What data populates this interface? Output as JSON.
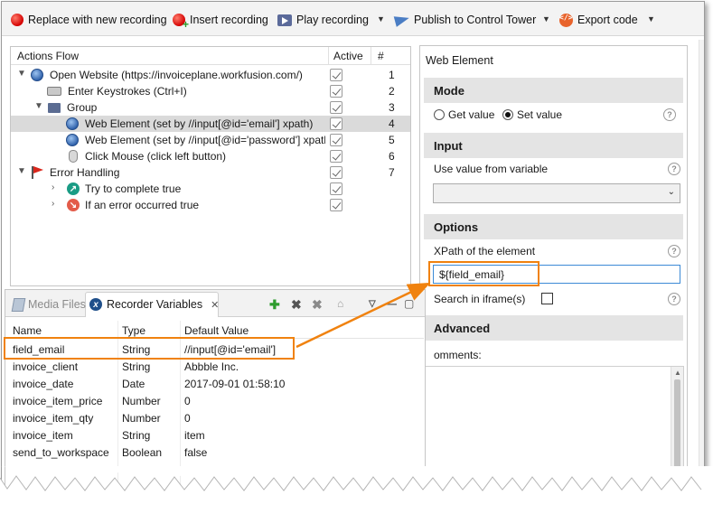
{
  "toolbar": {
    "replace_label": "Replace with new recording",
    "insert_label": "Insert recording",
    "play_label": "Play recording",
    "publish_label": "Publish to Control Tower",
    "export_label": "Export code"
  },
  "actions_flow": {
    "header": {
      "name": "Actions Flow",
      "active": "Active",
      "num": "#"
    },
    "rows": [
      {
        "label": "Open Website (https://invoiceplane.workfusion.com/)",
        "num": "1",
        "icon": "globe-icon"
      },
      {
        "label": "Enter Keystrokes (Ctrl+I)",
        "num": "2",
        "icon": "keyboard-icon"
      },
      {
        "label": "Group",
        "num": "3",
        "icon": "folder-icon"
      },
      {
        "label": "Web Element (set by //input[@id='email'] xpath)",
        "num": "4",
        "icon": "globe-icon",
        "selected": true
      },
      {
        "label": "Web Element (set by //input[@id='password'] xpath)",
        "num": "5",
        "icon": "globe-icon"
      },
      {
        "label": "Click Mouse (click left button)",
        "num": "6",
        "icon": "mouse-icon"
      },
      {
        "label": "Error Handling",
        "num": "7",
        "icon": "flag-icon"
      },
      {
        "label": "Try to complete true",
        "num": "",
        "icon": "try-icon"
      },
      {
        "label": "If an error occurred true",
        "num": "",
        "icon": "error-icon"
      }
    ]
  },
  "web_element": {
    "title": "Web Element",
    "mode": {
      "heading": "Mode",
      "get_label": "Get value",
      "set_label": "Set value",
      "selected": "Set value"
    },
    "input": {
      "heading": "Input",
      "variable_label": "Use value from variable",
      "variable_value": ""
    },
    "options": {
      "heading": "Options",
      "xpath_label": "XPath of the element",
      "xpath_value": "${field_email}",
      "iframe_label": "Search in iframe(s)"
    },
    "advanced": {
      "heading": "Advanced",
      "comments_label": "omments:"
    }
  },
  "bottom_panel": {
    "tabs": {
      "media": "Media Files",
      "recorder": "Recorder Variables"
    },
    "columns": {
      "name": "Name",
      "type": "Type",
      "default": "Default Value"
    },
    "variables": [
      {
        "name": "field_email",
        "type": "String",
        "default": "//input[@id='email']"
      },
      {
        "name": "invoice_client",
        "type": "String",
        "default": "Abbble Inc."
      },
      {
        "name": "invoice_date",
        "type": "Date",
        "default": "2017-09-01 01:58:10"
      },
      {
        "name": "invoice_item_price",
        "type": "Number",
        "default": "0"
      },
      {
        "name": "invoice_item_qty",
        "type": "Number",
        "default": "0"
      },
      {
        "name": "invoice_item",
        "type": "String",
        "default": "item"
      },
      {
        "name": "send_to_workspace",
        "type": "Boolean",
        "default": "false"
      }
    ]
  },
  "colors": {
    "callout": "#f0820f",
    "section_bg": "#e4e4e4",
    "selected_row": "#dadada",
    "focus_border": "#3c8ad6"
  }
}
